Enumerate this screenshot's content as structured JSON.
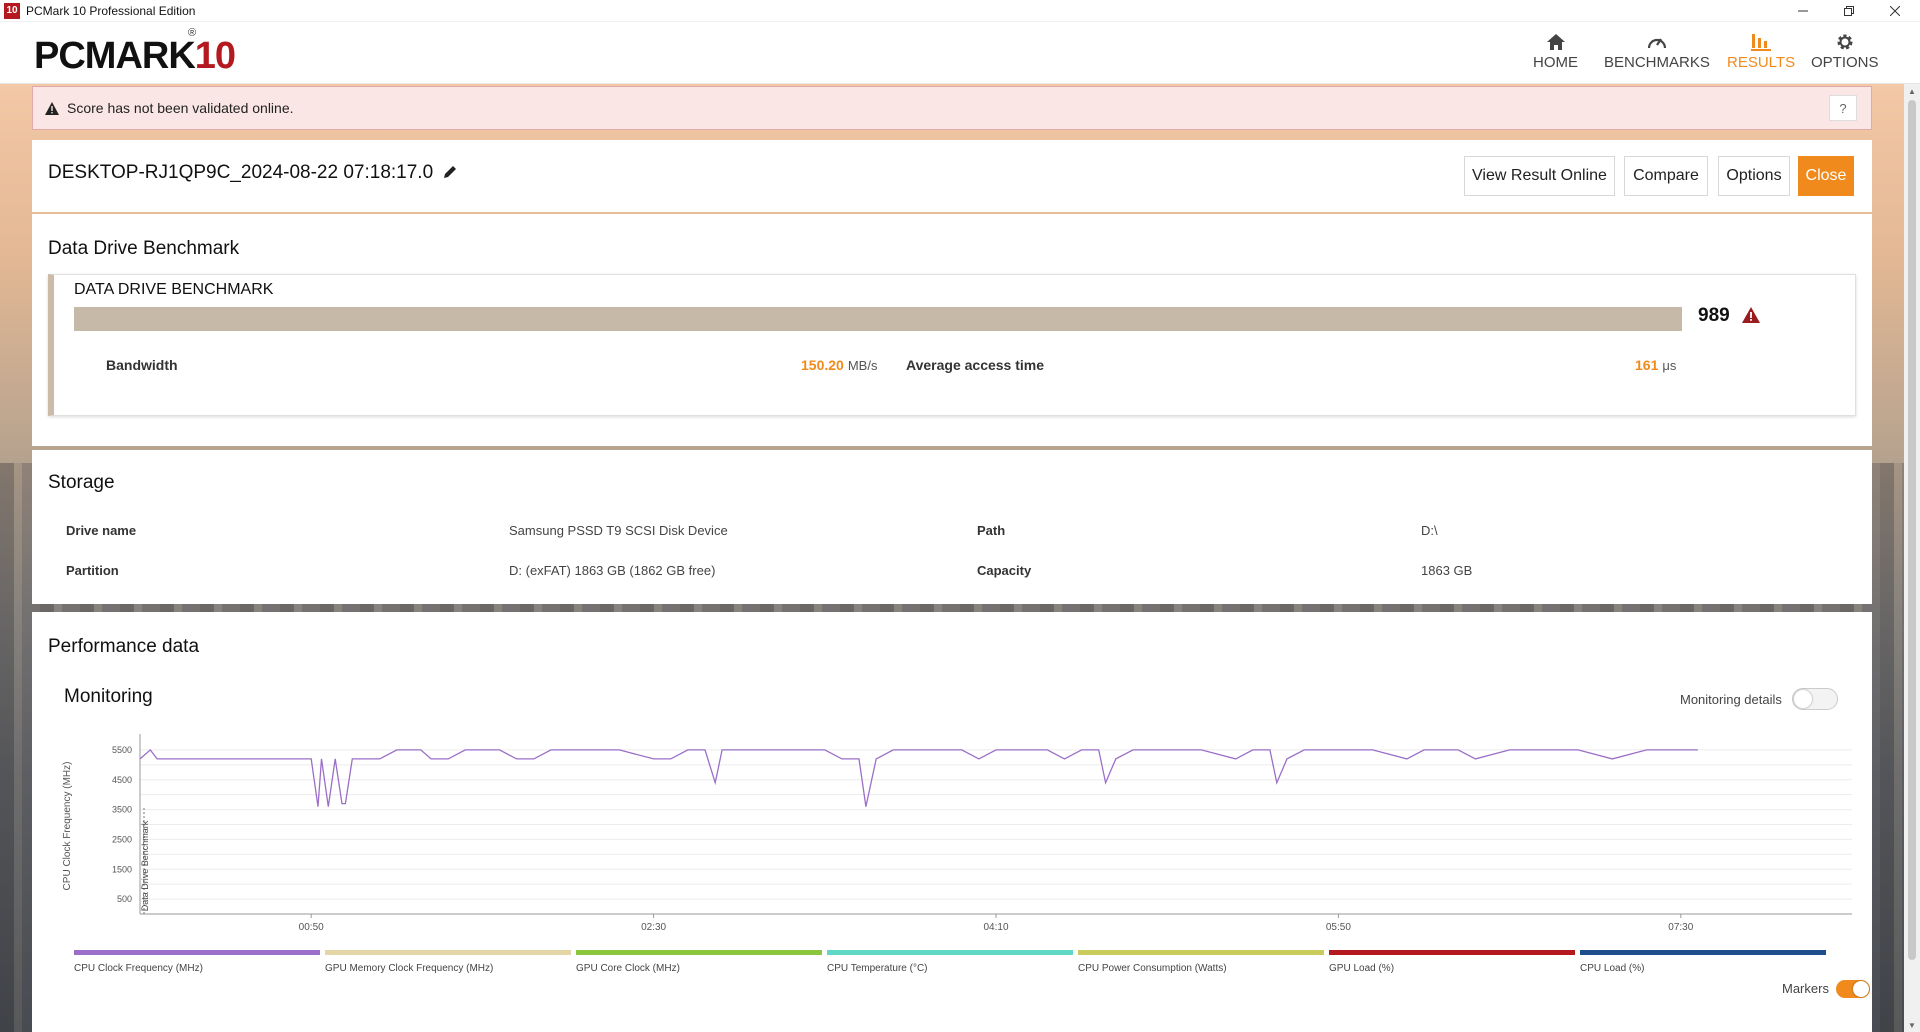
{
  "window": {
    "title": "PCMark 10 Professional Edition",
    "app_icon_text": "10"
  },
  "header": {
    "logo_main": "PCMARK",
    "logo_num": "10",
    "logo_reg": "®",
    "nav": [
      {
        "label": "HOME",
        "icon": "home-icon",
        "active": false
      },
      {
        "label": "BENCHMARKS",
        "icon": "gauge-icon",
        "active": false
      },
      {
        "label": "RESULTS",
        "icon": "bar-chart-icon",
        "active": true
      },
      {
        "label": "OPTIONS",
        "icon": "gear-icon",
        "active": false
      }
    ]
  },
  "warning": {
    "text": "Score has not been validated online.",
    "help": "?"
  },
  "result": {
    "title": "DESKTOP-RJ1QP9C_2024-08-22 07:18:17.0",
    "buttons": {
      "view_online": "View Result Online",
      "compare": "Compare",
      "options": "Options",
      "close": "Close"
    }
  },
  "benchmark": {
    "section_title": "Data Drive Benchmark",
    "name": "DATA DRIVE BENCHMARK",
    "score": "989",
    "bandwidth_label": "Bandwidth",
    "bandwidth_value": "150.20",
    "bandwidth_unit": "MB/s",
    "access_label": "Average access time",
    "access_value": "161",
    "access_unit": "μs"
  },
  "storage": {
    "section_title": "Storage",
    "drive_name_label": "Drive name",
    "drive_name_value": "Samsung PSSD T9 SCSI Disk Device",
    "path_label": "Path",
    "path_value": "D:\\",
    "partition_label": "Partition",
    "partition_value": "D: (exFAT) 1863 GB (1862 GB free)",
    "capacity_label": "Capacity",
    "capacity_value": "1863 GB"
  },
  "performance": {
    "section_title": "Performance data",
    "monitoring_title": "Monitoring",
    "monitoring_details_label": "Monitoring details",
    "monitoring_details_on": false,
    "markers_label": "Markers",
    "markers_on": true
  },
  "chart_data": {
    "type": "line",
    "ylabel": "CPU Clock Frequency (MHz)",
    "marker_label": "Data Drive Benchmark",
    "y_ticks": [
      500,
      1500,
      2500,
      3500,
      4500,
      5500
    ],
    "ylim": [
      0,
      5900
    ],
    "x_ticks": [
      "00:50",
      "02:30",
      "04:10",
      "05:50",
      "07:30"
    ],
    "x_tick_seconds": [
      50,
      150,
      250,
      350,
      450
    ],
    "xlim": [
      0,
      500
    ],
    "grid": true,
    "series": [
      {
        "name": "CPU Clock Frequency (MHz)",
        "color": "#9b6fc8",
        "x": [
          0,
          3,
          5,
          8,
          12,
          20,
          30,
          40,
          50,
          52,
          53,
          55,
          57,
          59,
          60,
          62,
          64,
          65,
          70,
          75,
          80,
          82,
          85,
          90,
          95,
          100,
          105,
          110,
          112,
          115,
          120,
          130,
          140,
          150,
          155,
          160,
          165,
          168,
          170,
          172,
          180,
          190,
          200,
          205,
          210,
          212,
          215,
          220,
          230,
          240,
          245,
          250,
          255,
          260,
          265,
          270,
          275,
          280,
          282,
          285,
          290,
          300,
          310,
          320,
          325,
          330,
          332,
          335,
          340,
          345,
          350,
          360,
          370,
          375,
          380,
          385,
          390,
          400,
          405,
          410,
          420,
          430,
          440,
          445,
          450,
          455
        ],
        "y": [
          5200,
          5500,
          5200,
          5200,
          5200,
          5200,
          5200,
          5200,
          5200,
          3600,
          5200,
          3600,
          5200,
          3700,
          3700,
          5200,
          5200,
          5200,
          5200,
          5500,
          5500,
          5500,
          5200,
          5200,
          5500,
          5500,
          5500,
          5200,
          5200,
          5200,
          5500,
          5500,
          5500,
          5200,
          5200,
          5500,
          5500,
          4400,
          5500,
          5500,
          5500,
          5500,
          5500,
          5200,
          5200,
          3600,
          5200,
          5500,
          5500,
          5500,
          5200,
          5500,
          5500,
          5500,
          5500,
          5200,
          5500,
          5500,
          4400,
          5200,
          5500,
          5500,
          5500,
          5200,
          5500,
          5500,
          4400,
          5200,
          5500,
          5500,
          5500,
          5500,
          5200,
          5500,
          5500,
          5500,
          5200,
          5500,
          5500,
          5500,
          5500,
          5200,
          5500,
          5500,
          5500,
          5500
        ]
      }
    ],
    "legend": [
      {
        "name": "CPU Clock Frequency (MHz)",
        "color": "#9b6fc8"
      },
      {
        "name": "GPU Memory Clock Frequency (MHz)",
        "color": "#e5d6a7"
      },
      {
        "name": "GPU Core Clock (MHz)",
        "color": "#8cc63f"
      },
      {
        "name": "CPU Temperature (°C)",
        "color": "#5fd8c5"
      },
      {
        "name": "CPU Power Consumption (Watts)",
        "color": "#c9cc5a"
      },
      {
        "name": "GPU Load (%)",
        "color": "#b3191f"
      },
      {
        "name": "CPU Load (%)",
        "color": "#1f4e8c"
      }
    ]
  }
}
